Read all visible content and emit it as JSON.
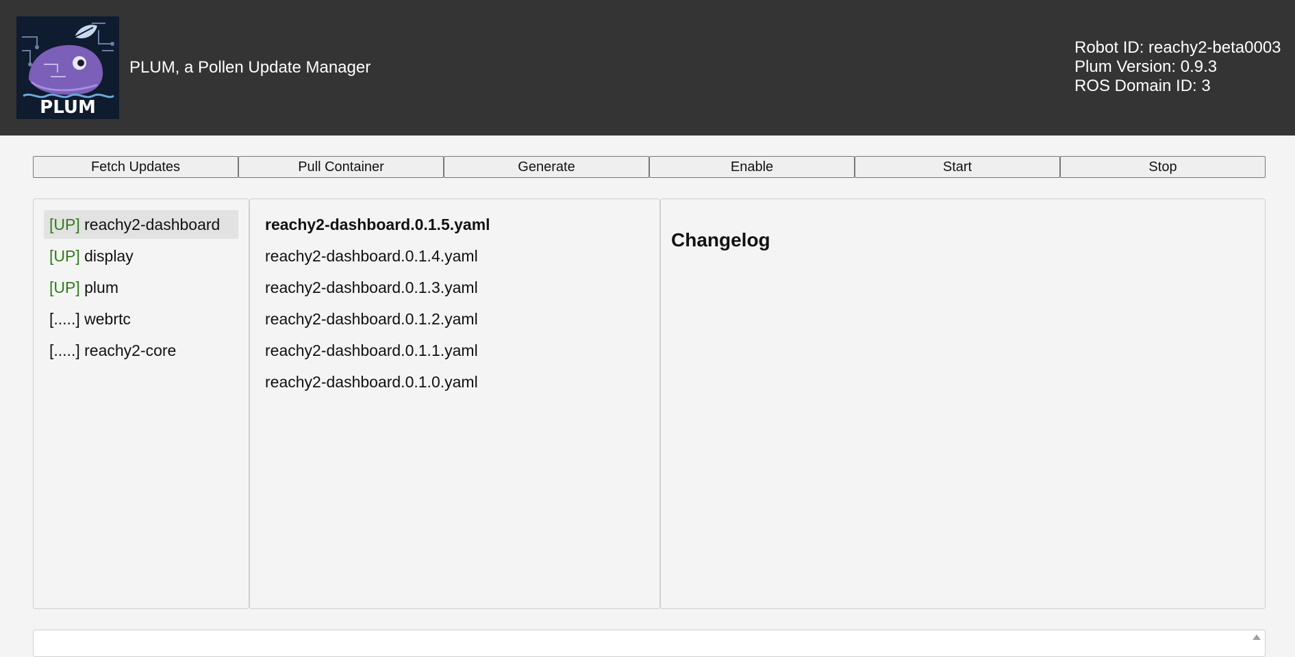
{
  "header": {
    "logo_text": "PLUM",
    "app_title": "PLUM, a Pollen Update Manager",
    "robot_id": "Robot ID: reachy2-beta0003",
    "plum_version": "Plum Version: 0.9.3",
    "ros_domain_id": "ROS Domain ID: 3"
  },
  "toolbar": {
    "fetch_updates": "Fetch Updates",
    "pull_container": "Pull Container",
    "generate": "Generate",
    "enable": "Enable",
    "start": "Start",
    "stop": "Stop"
  },
  "services": [
    {
      "status": "[UP]",
      "name": "reachy2-dashboard"
    },
    {
      "status": "[UP]",
      "name": "display"
    },
    {
      "status": "[UP]",
      "name": "plum"
    },
    {
      "status": "[.....]",
      "name": "webrtc"
    },
    {
      "status": "[.....]",
      "name": "reachy2-core"
    }
  ],
  "versions": [
    "reachy2-dashboard.0.1.5.yaml",
    "reachy2-dashboard.0.1.4.yaml",
    "reachy2-dashboard.0.1.3.yaml",
    "reachy2-dashboard.0.1.2.yaml",
    "reachy2-dashboard.0.1.1.yaml",
    "reachy2-dashboard.0.1.0.yaml"
  ],
  "changelog": {
    "title": "Changelog"
  },
  "colors": {
    "header_bg": "#343434",
    "status_up": "#2e7d18",
    "logo_bg": "#0f1b2e",
    "logo_whale": "#7b5fb8"
  },
  "icons": {
    "logo": "plum-whale-logo",
    "log_scroll": "scroll-up-arrow-icon"
  }
}
